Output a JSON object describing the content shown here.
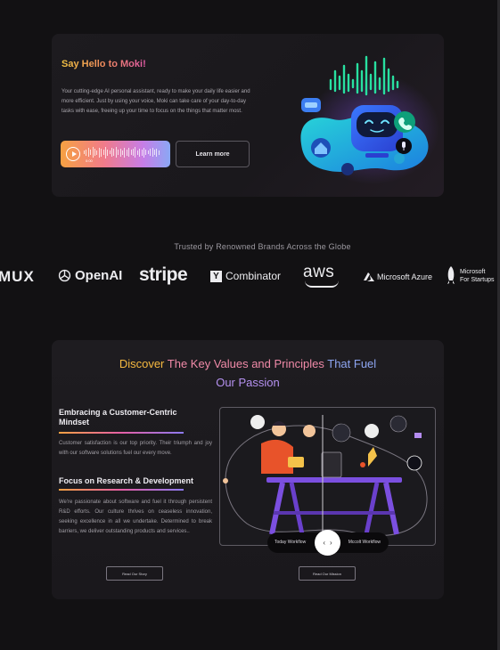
{
  "hero": {
    "title": "Say Hello to Moki!",
    "description": "Your cutting-edge AI personal assistant, ready to make your daily life easier and more efficient. Just by using your voice, Moki can take care of your day-to-day tasks with ease, freeing up your time to focus on the things that matter most.",
    "audio_time": "0:00",
    "learn_more_label": "Learn more"
  },
  "trusted": {
    "heading": "Trusted by Renowned Brands Across the Globe",
    "logos": {
      "mux": "MUX",
      "openai": "OpenAI",
      "stripe": "stripe",
      "ycombinator": "Combinator",
      "ycombinator_mark": "Y",
      "aws": "aws",
      "azure": "Microsoft Azure",
      "ms_startups_line1": "Microsoft",
      "ms_startups_line2": "For Startups"
    }
  },
  "values": {
    "title_part1": "Discover",
    "title_part2": "The Key Values and Principles",
    "title_part3": "That Fuel",
    "title_line2": "Our Passion",
    "section1_heading": "Embracing a Customer-Centric Mindset",
    "section1_text": "Customer satisfaction is our top priority. Their triumph and joy with our software solutions fuel our every move.",
    "section2_heading": "Focus on Research & Development",
    "section2_text": "We're passionate about software and fuel it through persistent R&D efforts. Our culture thrives on ceaseless innovation, seeking excellence in all we undertake. Determined to break barriers, we deliver outstanding products and services..",
    "toggle_left": "Today Workflow",
    "toggle_right": "Mccolt Workflow",
    "read_story_label": "Read Our Story",
    "read_mission_label": "Read Our Mission"
  },
  "colors": {
    "background": "#121113",
    "card": "#1d1b1f",
    "accent_orange": "#f6a142",
    "accent_pink": "#e55fa6",
    "accent_purple": "#8c7af0"
  }
}
